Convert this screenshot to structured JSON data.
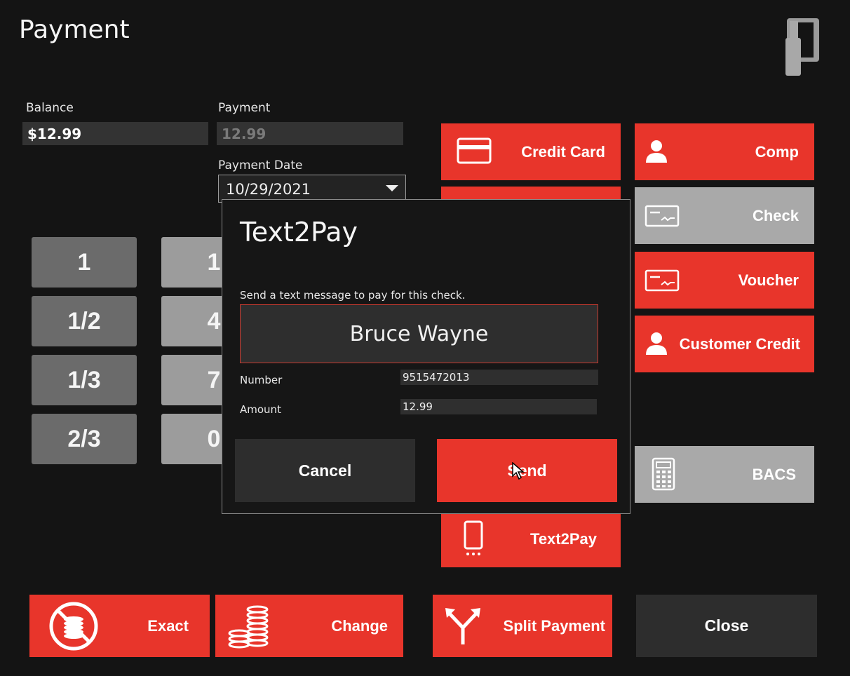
{
  "window": {
    "title": "Payment"
  },
  "balance": {
    "label": "Balance",
    "value": "$12.99"
  },
  "payment": {
    "label": "Payment",
    "value": "12.99"
  },
  "payment_date": {
    "label": "Payment Date",
    "value": "10/29/2021"
  },
  "keypad": {
    "left": [
      "1",
      "1/2",
      "1/3",
      "2/3"
    ],
    "right": [
      "1",
      "4",
      "7",
      "0"
    ]
  },
  "methods": {
    "credit_card": "Credit Card",
    "comp": "Comp",
    "check": "Check",
    "voucher": "Voucher",
    "customer_credit": "Customer Credit",
    "bacs": "BACS",
    "text2pay": "Text2Pay"
  },
  "bottom": {
    "exact": "Exact",
    "change": "Change",
    "split": "Split Payment",
    "close": "Close"
  },
  "dialog": {
    "title": "Text2Pay",
    "subtitle": "Send a text message to pay for this check.",
    "customer_name": "Bruce Wayne",
    "number_label": "Number",
    "number_value": "9515472013",
    "amount_label": "Amount",
    "amount_value": "12.99",
    "cancel": "Cancel",
    "send": "Send"
  },
  "colors": {
    "accent": "#e8352b",
    "background": "#141414",
    "disabled": "#a9a9a9"
  }
}
